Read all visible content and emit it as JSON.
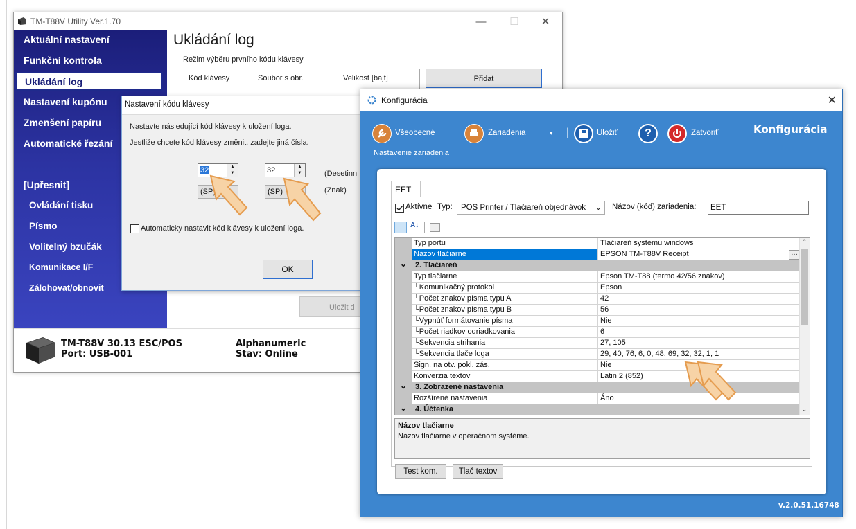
{
  "utility": {
    "title": "TM-T88V Utility Ver.1.70",
    "nav": [
      "Aktuální nastavení",
      "Funkční kontrola",
      "Ukládání log",
      "Nastavení kupónu",
      "Zmenšení papíru",
      "Automatické řezání"
    ],
    "nav_group": "[Upřesnit]",
    "nav_sub": [
      "Ovládání tisku",
      "Písmo",
      "Volitelný bzučák",
      "Komunikace I/F",
      "Zálohovat/obnovit"
    ],
    "page_title": "Ukládání log",
    "mode_label": "Režim výběru prvního kódu klávesy",
    "table_headers": [
      "Kód klávesy",
      "Soubor s obr.",
      "Velikost [bajt]"
    ],
    "add_button": "Přidat",
    "save_button": "Uložit d",
    "status": {
      "model": "TM-T88V 30.13 ESC/POS",
      "port": "Port: USB-001",
      "mode": "Alphanumeric",
      "state": "Stav: Online"
    }
  },
  "key_dialog": {
    "title": "Nastavení kódu klávesy",
    "line1": "Nastavte následující kód klávesy k uložení loga.",
    "line2": "Jestliže chcete kód klávesy změnit, zadejte jiná čísla.",
    "key1_value": "32",
    "key2_value": "32",
    "key1_char": "(SP)",
    "key2_char": "(SP)",
    "label_decimal": "(Desetinn",
    "label_char": "(Znak)",
    "auto_checkbox": "Automaticky nastavit kód klávesy k uložení loga.",
    "ok": "OK"
  },
  "konf": {
    "title": "Konfigurácia",
    "toolbar": {
      "general": "Všeobecné",
      "devices": "Zariadenia",
      "save": "Uložiť",
      "close": "Zatvoriť"
    },
    "header_title": "Konfigurácia",
    "subtitle": "Nastavenie zariadenia",
    "tab": "EET",
    "active_label": "Aktívne",
    "type_label": "Typ:",
    "type_value": "POS Printer / Tlačiareň objednávok",
    "device_name_label": "Názov (kód) zariadenia:",
    "device_name_value": "EET",
    "properties": [
      {
        "kind": "prop",
        "name": "Typ portu",
        "value": "Tlačiareň systému windows"
      },
      {
        "kind": "prop",
        "name": "Názov tlačiarne",
        "value": "EPSON TM-T88V Receipt",
        "selected": true
      },
      {
        "kind": "cat",
        "name": "2. Tlačiareň"
      },
      {
        "kind": "prop",
        "name": "Typ tlačiarne",
        "value": "Epson TM-T88 (termo 42/56 znakov)"
      },
      {
        "kind": "prop",
        "name": "└Komunikačný protokol",
        "value": "Epson"
      },
      {
        "kind": "prop",
        "name": "└Počet znakov písma typu A",
        "value": "42"
      },
      {
        "kind": "prop",
        "name": "└Počet znakov písma typu B",
        "value": "56"
      },
      {
        "kind": "prop",
        "name": "└Vypnúť formátovanie písma",
        "value": "Nie"
      },
      {
        "kind": "prop",
        "name": "└Počet riadkov odriadkovania",
        "value": "6"
      },
      {
        "kind": "prop",
        "name": "└Sekvencia strihania",
        "value": "27, 105"
      },
      {
        "kind": "prop",
        "name": "└Sekvencia tlače loga",
        "value": "29, 40, 76, 6, 0, 48, 69, 32, 32, 1, 1"
      },
      {
        "kind": "prop",
        "name": "Sign. na otv. pokl. zás.",
        "value": "Nie"
      },
      {
        "kind": "prop",
        "name": "Konverzia textov",
        "value": "Latin 2 (852)"
      },
      {
        "kind": "cat",
        "name": "3. Zobrazené nastavenia"
      },
      {
        "kind": "prop",
        "name": "Rozšírené nastavenia",
        "value": "Áno"
      },
      {
        "kind": "cat",
        "name": "4. Účtenka"
      }
    ],
    "desc_title": "Názov tlačiarne",
    "desc_text": "Názov tlačiarne v operačnom systéme.",
    "btn_test": "Test kom.",
    "btn_print": "Tlač textov",
    "version": "v.2.0.51.16748",
    "colors": {
      "blue": "#3d86cf",
      "select": "#0078d7",
      "nav": "#2c33a2"
    }
  }
}
